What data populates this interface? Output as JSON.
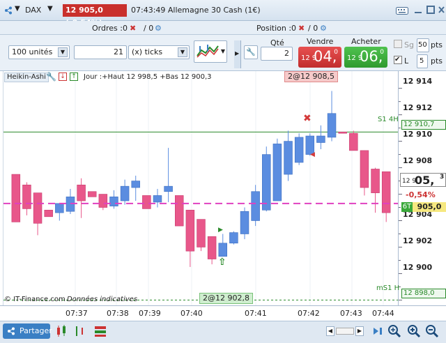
{
  "titlebar": {
    "symbol": "DAX",
    "price_badge": "12 905,0 (-0,54%)",
    "info": "07:43:49 Allemagne 30 Cash (1€)"
  },
  "orders": {
    "orders_label": "Ordres :",
    "orders_value": "0",
    "orders_slash": "/ 0",
    "position_label": "Position :",
    "position_value": "0",
    "position_slash": "/ 0"
  },
  "toolbar": {
    "units_select": "100 unités",
    "ticks_value": "21",
    "ticks_select": "(x) ticks",
    "qty_label": "Qté",
    "qty_value": "2",
    "sell_label": "Vendre",
    "sell_small": "12 9",
    "sell_big": "04,",
    "sell_sup": "0",
    "buy_label": "Acheter",
    "buy_small": "12 9",
    "buy_big": "06,",
    "buy_sup": "0",
    "sg_label": "Sg",
    "sg_value": "50",
    "pts_label1": "pts",
    "l_label": "L",
    "l_value": "5",
    "pts_label2": "pts"
  },
  "chart_header": {
    "type_label": "Heikin-Ashi",
    "jour": "Jour :+Haut 12 998,5 +Bas 12 900,3",
    "top_marker": "2@12 908,5",
    "bottom_marker": "2@12 902,8",
    "s1_label": "S1 4H",
    "ms1_label": "mS1 H",
    "footer": "© IT-Finance.com",
    "footer_italic": "Données indicatives"
  },
  "axis_labels": {
    "p914": "12 914",
    "p912": "12 912",
    "p910": "12 910",
    "p908": "12 908",
    "p904": "12 904",
    "p902": "12 902",
    "p900": "12 900",
    "s1_price": "12 910,7",
    "last_small": "12 9",
    "last_big": "05,",
    "last_sup": "3",
    "pct_change": "-0,54%",
    "bid_label": "6T",
    "bid_price": "905,0",
    "ms1_price": "12 898,0"
  },
  "time_labels": [
    "07:37",
    "07:38",
    "07:39",
    "07:40",
    "07:41",
    "07:42",
    "07:43",
    "07:44"
  ],
  "bottom": {
    "share_label": "Partager"
  },
  "colors": {
    "up": "#5b8de0",
    "down": "#e8578a",
    "dashed": "#e040c0",
    "s1": "#2a8a2a"
  },
  "chart_data": {
    "type": "candlestick",
    "y_unit": "price",
    "ylim": [
      12897.6,
      12915.3
    ],
    "candles": [
      {
        "o": 12907.5,
        "h": 12907.5,
        "c": 12903.9,
        "l": 12903.9
      },
      {
        "o": 12906.7,
        "h": 12906.9,
        "c": 12904.9,
        "l": 12904.4
      },
      {
        "o": 12906.1,
        "h": 12906.1,
        "c": 12903.8,
        "l": 12902.9
      },
      {
        "o": 12904.8,
        "h": 12904.8,
        "c": 12904.3,
        "l": 12904.3
      },
      {
        "o": 12904.6,
        "h": 12904.6,
        "c": 12905.3,
        "l": 12904.0
      },
      {
        "o": 12904.7,
        "h": 12906.4,
        "c": 12905.8,
        "l": 12904.5
      },
      {
        "o": 12906.7,
        "h": 12907.2,
        "c": 12905.5,
        "l": 12904.2
      },
      {
        "o": 12906.2,
        "h": 12906.2,
        "c": 12905.8,
        "l": 12905.8
      },
      {
        "o": 12906.0,
        "h": 12906.0,
        "c": 12905.0,
        "l": 12904.8
      },
      {
        "o": 12905.1,
        "h": 12906.3,
        "c": 12905.8,
        "l": 12904.9
      },
      {
        "o": 12905.5,
        "h": 12907.1,
        "c": 12906.6,
        "l": 12905.2
      },
      {
        "o": 12906.5,
        "h": 12907.4,
        "c": 12907.0,
        "l": 12905.5
      },
      {
        "o": 12905.9,
        "h": 12905.9,
        "c": 12904.9,
        "l": 12904.9
      },
      {
        "o": 12905.4,
        "h": 12906.4,
        "c": 12905.9,
        "l": 12905.0
      },
      {
        "o": 12906.2,
        "h": 12909.5,
        "c": 12906.6,
        "l": 12905.4
      },
      {
        "o": 12905.9,
        "h": 12905.9,
        "c": 12903.6,
        "l": 12903.6
      },
      {
        "o": 12904.8,
        "h": 12904.8,
        "c": 12901.7,
        "l": 12900.5
      },
      {
        "o": 12904.1,
        "h": 12904.1,
        "c": 12902.0,
        "l": 12901.7
      },
      {
        "o": 12902.8,
        "h": 12902.8,
        "c": 12901.1,
        "l": 12900.7
      },
      {
        "o": 12901.3,
        "h": 12903.0,
        "c": 12902.3,
        "l": 12901.3
      },
      {
        "o": 12902.3,
        "h": 12903.2,
        "c": 12903.1,
        "l": 12902.2
      },
      {
        "o": 12903.0,
        "h": 12905.0,
        "c": 12904.7,
        "l": 12902.6
      },
      {
        "o": 12904.0,
        "h": 12906.7,
        "c": 12906.2,
        "l": 12903.6
      },
      {
        "o": 12904.8,
        "h": 12909.6,
        "c": 12909.0,
        "l": 12904.7
      },
      {
        "o": 12905.5,
        "h": 12910.2,
        "c": 12909.8,
        "l": 12905.5
      },
      {
        "o": 12907.5,
        "h": 12910.8,
        "c": 12910.0,
        "l": 12907.0
      },
      {
        "o": 12908.4,
        "h": 12910.6,
        "c": 12910.3,
        "l": 12908.2
      },
      {
        "o": 12909.0,
        "h": 12910.6,
        "c": 12910.4,
        "l": 12908.9
      },
      {
        "o": 12909.9,
        "h": 12911.2,
        "c": 12910.4,
        "l": 12909.4
      },
      {
        "o": 12910.3,
        "h": 12913.8,
        "c": 12912.1,
        "l": 12910.0
      },
      {
        "o": 12910.7,
        "h": 12910.7,
        "c": 12910.6,
        "l": 12910.6
      },
      {
        "o": 12910.6,
        "h": 12910.8,
        "c": 12909.3,
        "l": 12909.3
      },
      {
        "o": 12909.3,
        "h": 12909.3,
        "c": 12906.5,
        "l": 12905.9
      },
      {
        "o": 12907.9,
        "h": 12908.0,
        "c": 12906.1,
        "l": 12904.6
      },
      {
        "o": 12907.7,
        "h": 12907.7,
        "c": 12904.6,
        "l": 12903.9
      }
    ],
    "dashed_line": 12905.3,
    "s1_line": 12910.7,
    "ms1_line": 12898.0
  }
}
